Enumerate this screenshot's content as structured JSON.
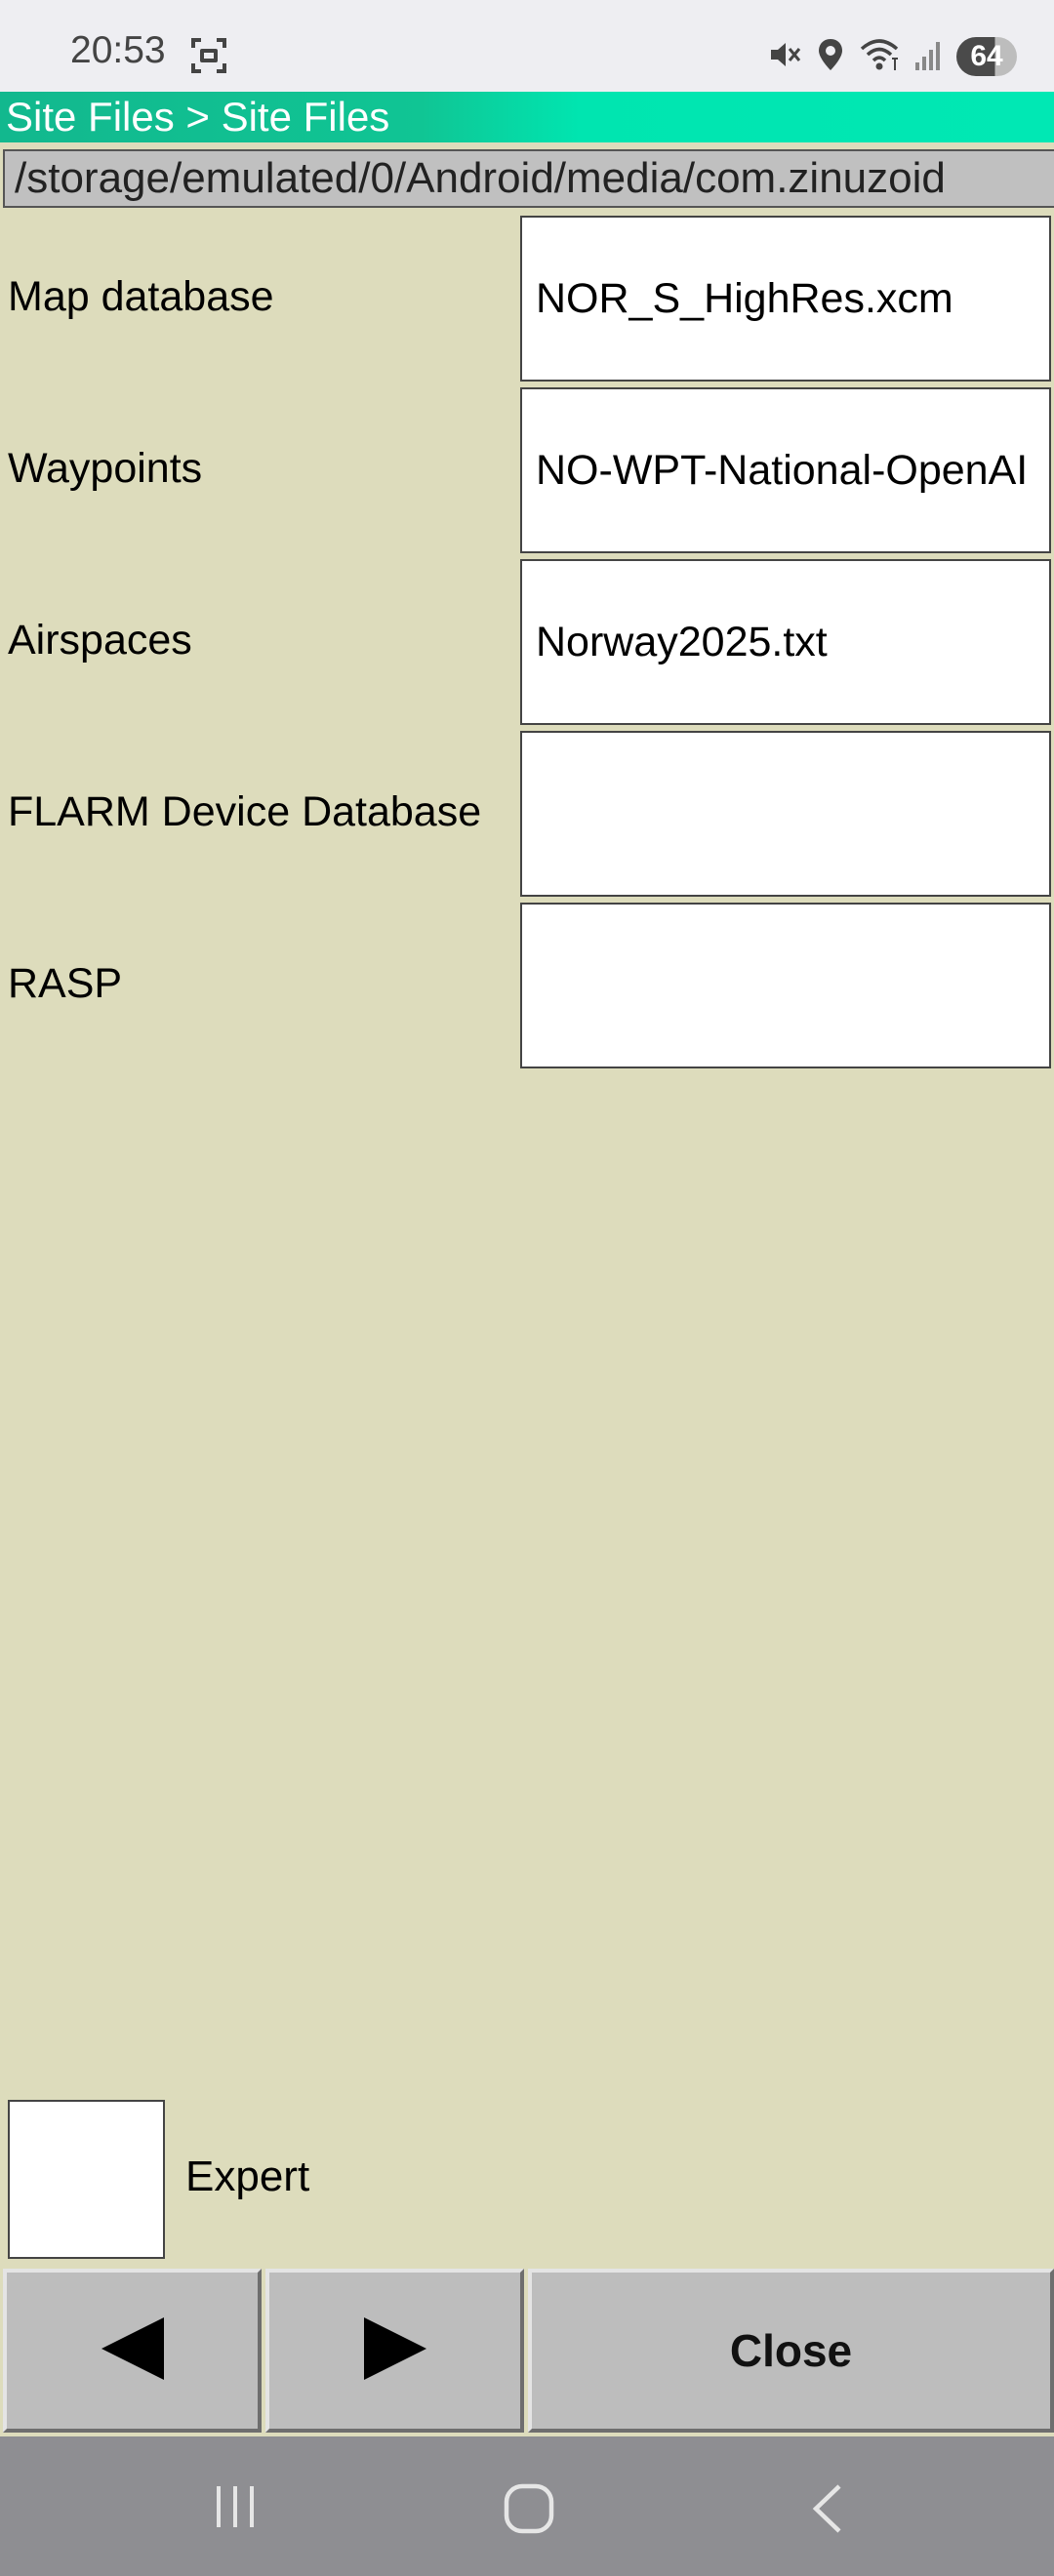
{
  "status": {
    "time": "20:53",
    "battery": "64"
  },
  "title": "Site Files > Site Files",
  "path": "/storage/emulated/0/Android/media/com.zinuzoid",
  "rows": [
    {
      "label": "Map database",
      "value": "NOR_S_HighRes.xcm"
    },
    {
      "label": "Waypoints",
      "value": "NO-WPT-National-OpenAI"
    },
    {
      "label": "Airspaces",
      "value": "Norway2025.txt"
    },
    {
      "label": "FLARM Device Database",
      "value": ""
    },
    {
      "label": "RASP",
      "value": ""
    }
  ],
  "expert": {
    "label": "Expert",
    "checked": false
  },
  "buttons": {
    "prev_icon": "left-triangle",
    "next_icon": "right-triangle",
    "close_label": "Close"
  },
  "navigation": {
    "recent_icon": "recent-apps-icon",
    "home_icon": "home-icon",
    "back_icon": "back-icon"
  },
  "colors": {
    "background": "#dddcbc",
    "title_gradient_start": "#12b88e",
    "title_gradient_end": "#00e8b4",
    "button": "#bdbdbd",
    "nav_bar": "#8e8e92"
  }
}
